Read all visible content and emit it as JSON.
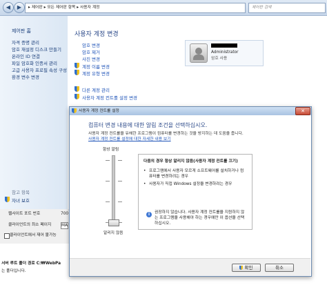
{
  "address_bar": {
    "breadcrumb": "▸ 제어판 ▸ 모든 제어판 항목 ▸ 사용자 계정",
    "search_placeholder": "제어판 검색"
  },
  "sidebar": {
    "home": "제어판 홈",
    "items": [
      "자격 증명 관리",
      "암호 재설정 디스크 만들기",
      "온라인 ID 연결",
      "파일 암호화 인증서 관리",
      "고급 사용자 프로필 속성 구성",
      "환경 변수 변경"
    ],
    "see_also_title": "참고 항목",
    "see_also_items": [
      "자녀 보호"
    ]
  },
  "main": {
    "title": "사용자 계정 변경",
    "links": [
      "암호 변경",
      "암호 제거",
      "사진 변경"
    ],
    "shield_links": [
      "계정 이름 변경",
      "계정 유형 변경"
    ],
    "links2": [
      "다른 계정 관리"
    ],
    "shield_links2": [
      "사용자 계정 컨트롤 설정 변경"
    ],
    "user": {
      "name": "Administrator",
      "role": "암호 사용"
    }
  },
  "background_fields": {
    "item1": "웹사이트 포트 번호",
    "item1_value": "700",
    "item2": "클라이언트의 최소 페이지",
    "item2_value": "MA",
    "item3": "클라이언트에서 재어 불가능"
  },
  "background_text": {
    "line1": "서버 루트 폴더 경로 C:₩WebPa",
    "line2": "는 폴더입니다."
  },
  "dialog": {
    "title": "사용자 계정 컨트롤 설정",
    "heading": "컴퓨터 변경 내용에 대한 알림 조건을 선택하십시오.",
    "description": "사용자 계정 컨트롤을 유해한 프로그램이 컴퓨터를 변경하는 것을 방지하는 데 도움을 줍니다.",
    "more_link": "사용자 계정 컨트롤 설정에 대한 자세한 내용 보기",
    "slider_top": "항상 알림",
    "slider_bottom": "알리지 않음",
    "slider_level": 0,
    "option_title": "다음의 경우 항상 알리지 않음(사용자 계정 컨트롤 끄기)",
    "bullets": [
      "프로그램에서 사용자 모르게 소프트웨어를 설치하거나 컴퓨터를 변경하려는 경우",
      "사용자가 직접 Windows 설정을 변경하려는 경우"
    ],
    "warning": "권장하지 않습니다. 사용자 계정 컨트롤을 지원하지 않는 프로그램을 사용해야 하는 경우에만 이 옵션을 선택하십시오.",
    "ok_label": "확인",
    "cancel_label": "취소"
  },
  "icons": {
    "back": "back-arrow-icon",
    "forward": "forward-arrow-icon",
    "shield": "uac-shield-icon",
    "info": "info-icon",
    "close": "close-icon"
  },
  "colors": {
    "link": "#1f54b8",
    "heading": "#2c4a8a",
    "accent": "#3f78d4"
  }
}
